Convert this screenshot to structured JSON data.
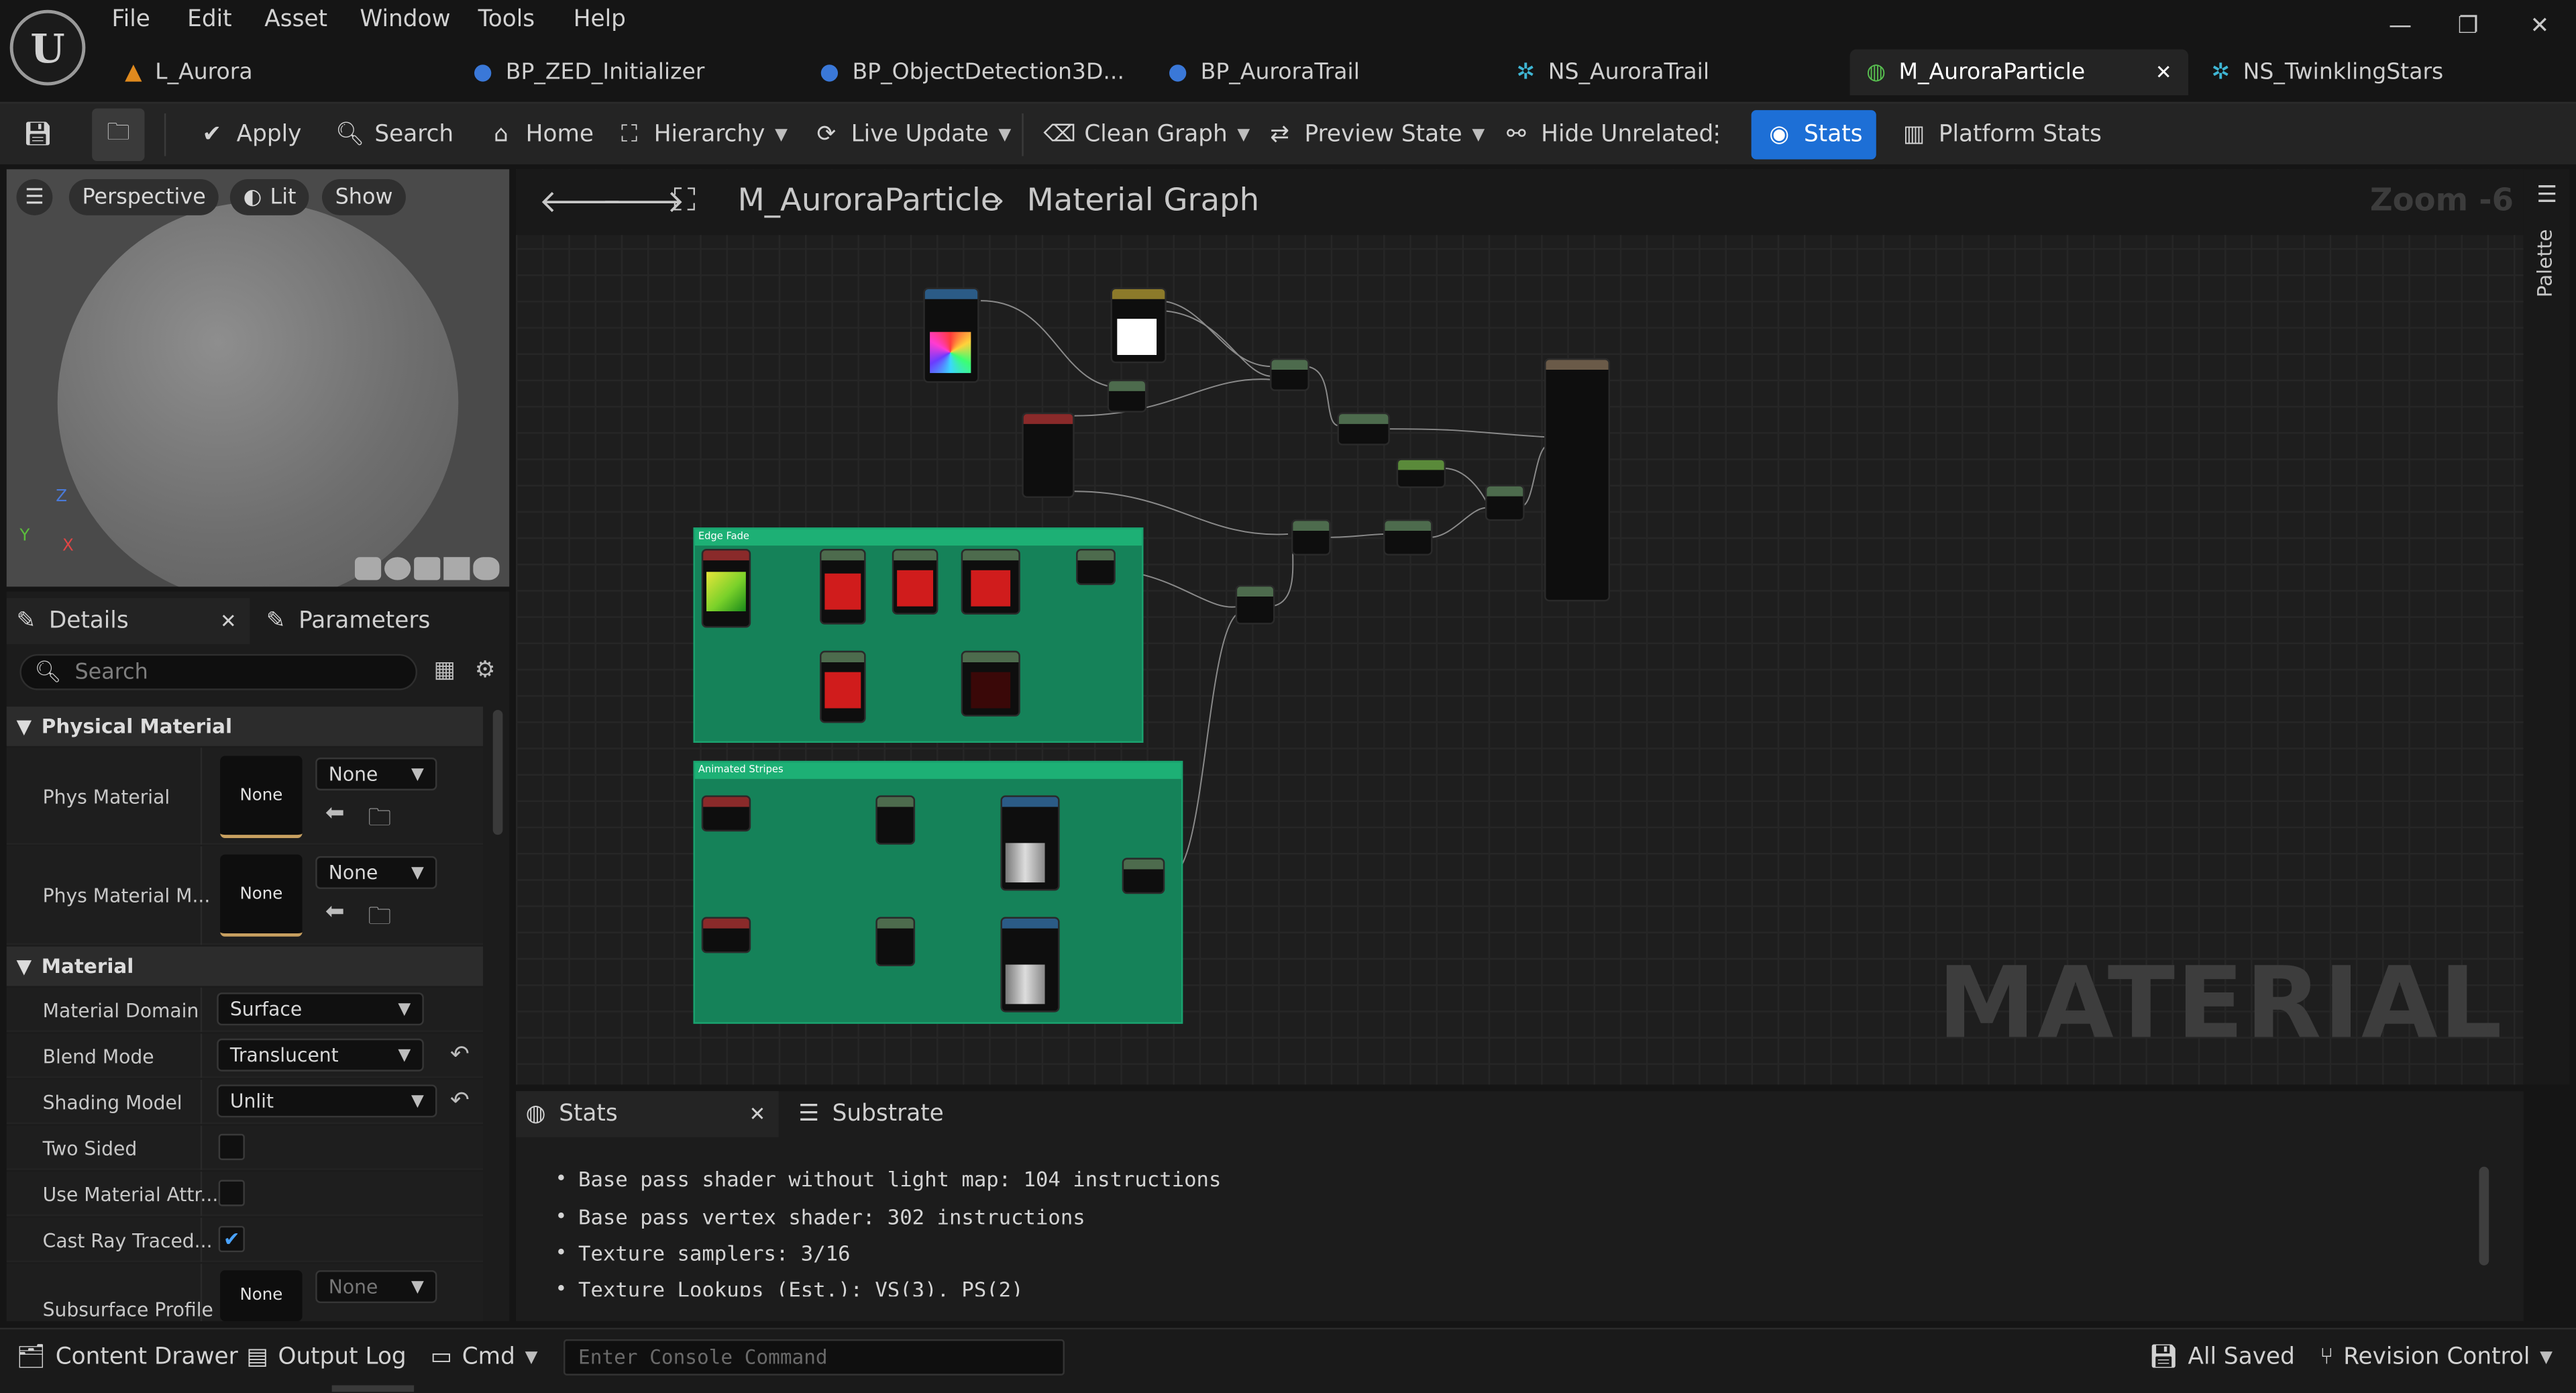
{
  "menu": [
    "File",
    "Edit",
    "Asset",
    "Window",
    "Tools",
    "Help"
  ],
  "tabs": [
    {
      "label": "L_Aurora",
      "icon": "level-icon"
    },
    {
      "label": "BP_ZED_Initializer",
      "icon": "blueprint-icon"
    },
    {
      "label": "BP_ObjectDetection3D...",
      "icon": "blueprint-icon"
    },
    {
      "label": "BP_AuroraTrail",
      "icon": "blueprint-icon"
    },
    {
      "label": "NS_AuroraTrail",
      "icon": "niagara-icon"
    },
    {
      "label": "M_AuroraParticle",
      "icon": "material-icon",
      "active": true
    },
    {
      "label": "NS_TwinklingStars",
      "icon": "niagara-icon"
    }
  ],
  "toolbar": {
    "apply": "Apply",
    "search": "Search",
    "home": "Home",
    "hierarchy": "Hierarchy",
    "live_update": "Live Update",
    "clean_graph": "Clean Graph",
    "preview_state": "Preview State",
    "hide_unrelated": "Hide Unrelated",
    "stats": "Stats",
    "platform_stats": "Platform Stats"
  },
  "viewport": {
    "perspective": "Perspective",
    "lit": "Lit",
    "show": "Show",
    "axis_z": "Z",
    "axis_y": "Y",
    "axis_x": "X"
  },
  "details": {
    "tab_details": "Details",
    "tab_parameters": "Parameters",
    "search_placeholder": "Search",
    "section_physical": "Physical Material",
    "section_material": "Material",
    "phys_material_label": "Phys Material",
    "phys_material_mask_label": "Phys Material M...",
    "none": "None",
    "material_domain_label": "Material Domain",
    "material_domain_value": "Surface",
    "blend_mode_label": "Blend Mode",
    "blend_mode_value": "Translucent",
    "shading_model_label": "Shading Model",
    "shading_model_value": "Unlit",
    "two_sided_label": "Two Sided",
    "use_material_attr_label": "Use Material Attr...",
    "cast_ray_traced_label": "Cast Ray Traced...",
    "subsurface_profile_label": "Subsurface Profile"
  },
  "graph": {
    "breadcrumb_asset": "M_AuroraParticle",
    "breadcrumb_graph": "Material Graph",
    "zoom": "Zoom -6",
    "watermark": "MATERIAL",
    "palette": "Palette",
    "comment_edge_fade": "Edge Fade",
    "comment_animated_stripes": "Animated Stripes"
  },
  "stats_panel": {
    "tab_stats": "Stats",
    "tab_substrate": "Substrate",
    "lines": [
      "Base pass shader without light map: 104 instructions",
      "Base pass vertex shader: 302 instructions",
      "Texture samplers: 3/16",
      "Texture Lookups (Est.): VS(3), PS(2)"
    ]
  },
  "bottom": {
    "content_drawer": "Content Drawer",
    "output_log": "Output Log",
    "cmd": "Cmd",
    "console_placeholder": "Enter Console Command",
    "all_saved": "All Saved",
    "revision_control": "Revision Control"
  },
  "colors": {
    "accent_blue": "#1d6fd6",
    "comment_green": "#158259",
    "level_orange": "#e08a1e",
    "blueprint_blue": "#3a78d8",
    "niagara_cyan": "#3fb6d4",
    "material_green": "#58c050"
  }
}
